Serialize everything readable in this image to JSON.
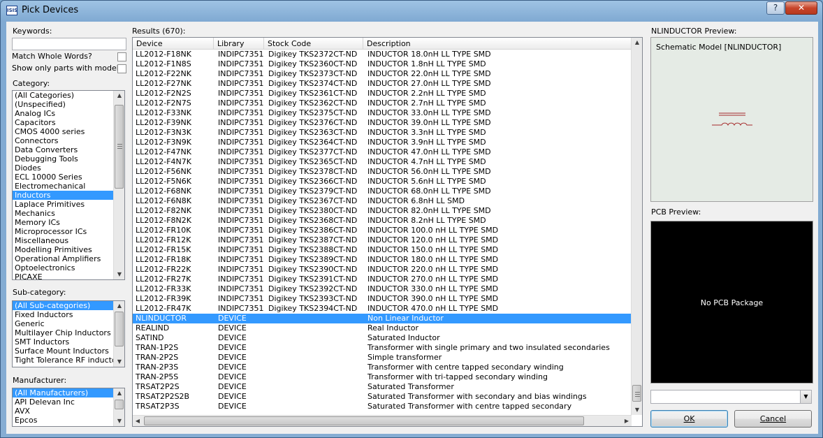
{
  "window": {
    "title": "Pick Devices",
    "icon_text": "ISIS",
    "help_glyph": "?",
    "close_glyph": "✕"
  },
  "left": {
    "keywords_label": "Keywords:",
    "keywords_value": "",
    "match_whole_words": "Match Whole Words?",
    "only_models": "Show only parts with models?",
    "category_label": "Category:",
    "categories": [
      "(All Categories)",
      "(Unspecified)",
      "Analog ICs",
      "Capacitors",
      "CMOS 4000 series",
      "Connectors",
      "Data Converters",
      "Debugging Tools",
      "Diodes",
      "ECL 10000 Series",
      "Electromechanical",
      "Inductors",
      "Laplace Primitives",
      "Mechanics",
      "Memory ICs",
      "Microprocessor ICs",
      "Miscellaneous",
      "Modelling Primitives",
      "Operational Amplifiers",
      "Optoelectronics",
      "PICAXE"
    ],
    "category_selected": 11,
    "subcategory_label": "Sub-category:",
    "subcategories": [
      "(All Sub-categories)",
      "Fixed Inductors",
      "Generic",
      "Multilayer Chip Inductors",
      "SMT Inductors",
      "Surface Mount Inductors",
      "Tight Tolerance RF inductor"
    ],
    "subcategory_selected": 0,
    "manufacturer_label": "Manufacturer:",
    "manufacturers": [
      "(All Manufacturers)",
      "API Delevan Inc",
      "AVX",
      "Epcos"
    ],
    "manufacturer_selected": 0
  },
  "results": {
    "label": "Results (670):",
    "columns": [
      "Device",
      "Library",
      "Stock Code",
      "Description"
    ],
    "rows": [
      [
        "LL2012-F18NK",
        "INDIPC7351",
        "Digikey TKS2372CT-ND",
        "INDUCTOR 18.0nH LL TYPE SMD"
      ],
      [
        "LL2012-F1N8S",
        "INDIPC7351",
        "Digikey TKS2360CT-ND",
        "INDUCTOR 1.8nH LL TYPE SMD"
      ],
      [
        "LL2012-F22NK",
        "INDIPC7351",
        "Digikey TKS2373CT-ND",
        "INDUCTOR 22.0nH LL TYPE SMD"
      ],
      [
        "LL2012-F27NK",
        "INDIPC7351",
        "Digikey TKS2374CT-ND",
        "INDUCTOR 27.0nH LL TYPE SMD"
      ],
      [
        "LL2012-F2N2S",
        "INDIPC7351",
        "Digikey TKS2361CT-ND",
        "INDUCTOR 2.2nH LL TYPE SMD"
      ],
      [
        "LL2012-F2N7S",
        "INDIPC7351",
        "Digikey TKS2362CT-ND",
        "INDUCTOR 2.7nH LL TYPE SMD"
      ],
      [
        "LL2012-F33NK",
        "INDIPC7351",
        "Digikey TKS2375CT-ND",
        "INDUCTOR 33.0nH LL TYPE SMD"
      ],
      [
        "LL2012-F39NK",
        "INDIPC7351",
        "Digikey TKS2376CT-ND",
        "INDUCTOR 39.0nH LL TYPE SMD"
      ],
      [
        "LL2012-F3N3K",
        "INDIPC7351",
        "Digikey TKS2363CT-ND",
        "INDUCTOR 3.3nH LL TYPE SMD"
      ],
      [
        "LL2012-F3N9K",
        "INDIPC7351",
        "Digikey TKS2364CT-ND",
        "INDUCTOR 3.9nH LL TYPE SMD"
      ],
      [
        "LL2012-F47NK",
        "INDIPC7351",
        "Digikey TKS2377CT-ND",
        "INDUCTOR 47.0nH LL TYPE SMD"
      ],
      [
        "LL2012-F4N7K",
        "INDIPC7351",
        "Digikey TKS2365CT-ND",
        "INDUCTOR 4.7nH LL TYPE SMD"
      ],
      [
        "LL2012-F56NK",
        "INDIPC7351",
        "Digikey TKS2378CT-ND",
        "INDUCTOR 56.0nH LL TYPE SMD"
      ],
      [
        "LL2012-F5N6K",
        "INDIPC7351",
        "Digikey TKS2366CT-ND",
        "INDUCTOR 5.6nH LL TYPE SMD"
      ],
      [
        "LL2012-F68NK",
        "INDIPC7351",
        "Digikey TKS2379CT-ND",
        "INDUCTOR 68.0nH LL TYPE SMD"
      ],
      [
        "LL2012-F6N8K",
        "INDIPC7351",
        "Digikey TKS2367CT-ND",
        "INDUCTOR 6.8nH LL SMD"
      ],
      [
        "LL2012-F82NK",
        "INDIPC7351",
        "Digikey TKS2380CT-ND",
        "INDUCTOR 82.0nH LL TYPE SMD"
      ],
      [
        "LL2012-F8N2K",
        "INDIPC7351",
        "Digikey TKS2368CT-ND",
        "INDUCTOR 8.2nH LL TYPE SMD"
      ],
      [
        "LL2012-FR10K",
        "INDIPC7351",
        "Digikey TKS2386CT-ND",
        "INDUCTOR 100.0 nH LL TYPE SMD"
      ],
      [
        "LL2012-FR12K",
        "INDIPC7351",
        "Digikey TKS2387CT-ND",
        "INDUCTOR 120.0 nH LL TYPE SMD"
      ],
      [
        "LL2012-FR15K",
        "INDIPC7351",
        "Digikey TKS2388CT-ND",
        "INDUCTOR 150.0 nH LL TYPE SMD"
      ],
      [
        "LL2012-FR18K",
        "INDIPC7351",
        "Digikey TKS2389CT-ND",
        "INDUCTOR 180.0 nH LL TYPE SMD"
      ],
      [
        "LL2012-FR22K",
        "INDIPC7351",
        "Digikey TKS2390CT-ND",
        "INDUCTOR 220.0 nH LL TYPE SMD"
      ],
      [
        "LL2012-FR27K",
        "INDIPC7351",
        "Digikey TKS2391CT-ND",
        "INDUCTOR 270.0 nH LL TYPE SMD"
      ],
      [
        "LL2012-FR33K",
        "INDIPC7351",
        "Digikey TKS2392CT-ND",
        "INDUCTOR 330.0 nH LL TYPE SMD"
      ],
      [
        "LL2012-FR39K",
        "INDIPC7351",
        "Digikey TKS2393CT-ND",
        "INDUCTOR 390.0 nH LL TYPE SMD"
      ],
      [
        "LL2012-FR47K",
        "INDIPC7351",
        "Digikey TKS2394CT-ND",
        "INDUCTOR 470.0 nH LL TYPE SMD"
      ],
      [
        "NLINDUCTOR",
        "DEVICE",
        "",
        "Non Linear Inductor"
      ],
      [
        "REALIND",
        "DEVICE",
        "",
        "Real Inductor"
      ],
      [
        "SATIND",
        "DEVICE",
        "",
        "Saturated Inductor"
      ],
      [
        "TRAN-1P2S",
        "DEVICE",
        "",
        "Transformer with single primary and two insulated secondaries"
      ],
      [
        "TRAN-2P2S",
        "DEVICE",
        "",
        "Simple transformer"
      ],
      [
        "TRAN-2P3S",
        "DEVICE",
        "",
        "Transformer with centre tapped secondary winding"
      ],
      [
        "TRAN-2P5S",
        "DEVICE",
        "",
        "Transformer with tri-tapped secondary winding"
      ],
      [
        "TRSAT2P2S",
        "DEVICE",
        "",
        "Saturated Transformer"
      ],
      [
        "TRSAT2P2S2B",
        "DEVICE",
        "",
        "Saturated Transformer with secondary and bias windings"
      ],
      [
        "TRSAT2P3S",
        "DEVICE",
        "",
        "Saturated Transformer with centre tapped secondary"
      ]
    ],
    "selected_row": 27
  },
  "preview": {
    "label": "NLINDUCTOR Preview:",
    "model_text": "Schematic Model [NLINDUCTOR]",
    "symbol_color": "#a52a2a"
  },
  "pcb": {
    "label": "PCB Preview:",
    "text": "No PCB Package"
  },
  "package_combo": {
    "value": ""
  },
  "buttons": {
    "ok": "OK",
    "cancel": "Cancel"
  }
}
